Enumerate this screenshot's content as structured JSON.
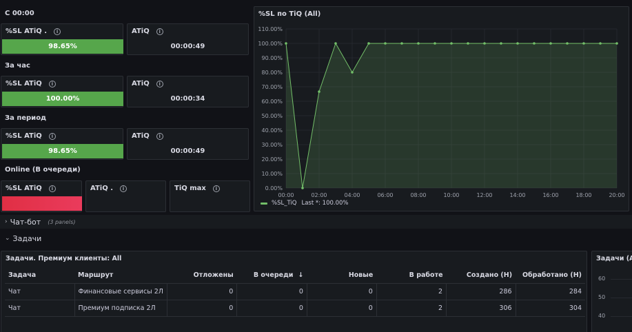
{
  "sections": {
    "s1": "С 00:00",
    "s2": "За час",
    "s3": "За период",
    "s4": "Online (В очереди)"
  },
  "stats": {
    "s1_sl_title": "%SL ATiQ .",
    "s1_sl_value": "98.65%",
    "s1_sl_level": 1.0,
    "s1_atiq_title": "ATiQ",
    "s1_atiq_value": "00:00:49",
    "s2_sl_title": "%SL ATiQ",
    "s2_sl_value": "100.00%",
    "s2_sl_level": 1.0,
    "s2_atiq_title": "ATiQ",
    "s2_atiq_value": "00:00:34",
    "s3_sl_title": "%SL ATiQ",
    "s3_sl_value": "98.65%",
    "s3_sl_level": 1.0,
    "s3_atiq_title": "ATiQ",
    "s3_atiq_value": "00:00:49",
    "s4_sl_title": "%SL ATiQ",
    "s4_atiq_title": "ATiQ .",
    "s4_tiq_title": "TiQ max"
  },
  "colors": {
    "green": "#56a64b",
    "red": "#e02f44",
    "series": "#73bf69"
  },
  "rows": {
    "chatbot_label": "Чат-бот",
    "chatbot_sub": "(3 panels)",
    "tasks_label": "Задачи"
  },
  "chart_panel": {
    "title": "%SL по TiQ (All)",
    "legend_name": "%SL_TiQ",
    "legend_stat": "Last *: 100.00%"
  },
  "chart_data": {
    "type": "area",
    "title": "%SL по TiQ (All)",
    "y_ticks": [
      "0.00%",
      "10.00%",
      "20.00%",
      "30.00%",
      "40.00%",
      "50.00%",
      "60.00%",
      "70.00%",
      "80.00%",
      "90.00%",
      "100.00%",
      "110.00%"
    ],
    "x_ticks": [
      "00:00",
      "02:00",
      "04:00",
      "06:00",
      "08:00",
      "10:00",
      "12:00",
      "14:00",
      "16:00",
      "18:00",
      "20:00"
    ],
    "ylim": [
      0,
      110
    ],
    "xlim": [
      0,
      20
    ],
    "grid": true,
    "legend": "bottom-left",
    "series": [
      {
        "name": "%SL_TiQ",
        "x": [
          0,
          1,
          2,
          3,
          4,
          5,
          6,
          7,
          8,
          9,
          10,
          11,
          12,
          13,
          14,
          15,
          16,
          17,
          18,
          19,
          20
        ],
        "values": [
          100,
          0,
          66.67,
          100,
          80,
          100,
          100,
          100,
          100,
          100,
          100,
          100,
          100,
          100,
          100,
          100,
          100,
          100,
          100,
          100,
          100
        ]
      }
    ]
  },
  "table": {
    "title": "Задачи. Премиум клиенты: All",
    "sort_icon": "arrow-down-icon",
    "columns": [
      "Задача",
      "Маршрут",
      "Отложены",
      "В очереди",
      "Новые",
      "В работе",
      "Создано (Н)",
      "Обработано (Н)"
    ],
    "rows": [
      [
        "Чат",
        "Финансовые сервисы 2Л",
        "0",
        "0",
        "0",
        "2",
        "286",
        "284"
      ],
      [
        "Чат",
        "Премиум подписка 2Л",
        "0",
        "0",
        "0",
        "2",
        "306",
        "304"
      ]
    ]
  },
  "right_panel": {
    "title": "Задачи (All)",
    "y_ticks": [
      "60",
      "50",
      "40"
    ]
  }
}
